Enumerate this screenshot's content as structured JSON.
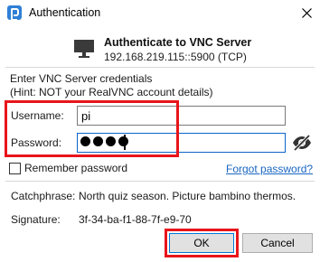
{
  "window": {
    "title": "Authentication"
  },
  "header": {
    "title": "Authenticate to VNC Server",
    "server": "192.168.219.115::5900 (TCP)"
  },
  "credentials": {
    "line1": "Enter VNC Server credentials",
    "line2": "(Hint: NOT your RealVNC account details)"
  },
  "username": {
    "label": "Username:",
    "value": "pi"
  },
  "password": {
    "label": "Password:",
    "masked_length": 4
  },
  "remember": {
    "label": "Remember password",
    "checked": false
  },
  "forgot": {
    "label": "Forgot password?"
  },
  "catchphrase": {
    "label": "Catchphrase:",
    "value": "North quiz season. Picture bambino thermos."
  },
  "signature": {
    "label": "Signature:",
    "value": "3f-34-ba-f1-88-7f-e9-70"
  },
  "buttons": {
    "ok": "OK",
    "cancel": "Cancel"
  },
  "colors": {
    "highlight": "#e8151b",
    "link": "#1a66c2",
    "accent": "#0078d7"
  }
}
